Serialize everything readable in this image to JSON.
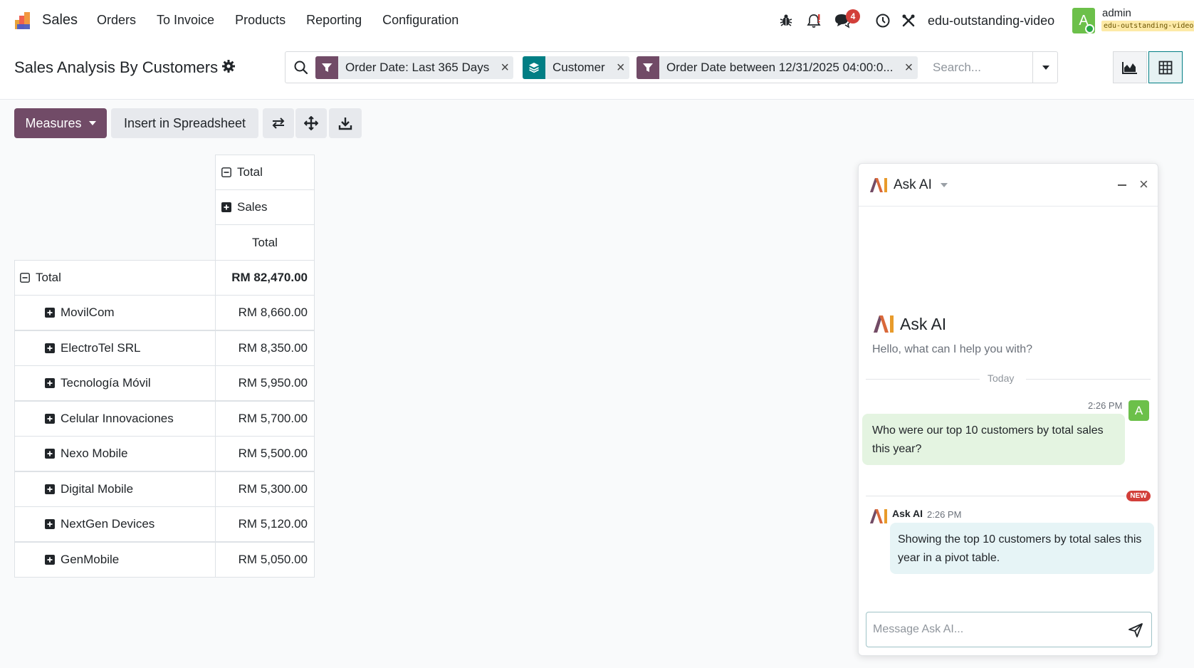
{
  "nav": {
    "app": "Sales",
    "menu": [
      "Orders",
      "To Invoice",
      "Products",
      "Reporting",
      "Configuration"
    ],
    "message_count": "4",
    "database": "edu-outstanding-video",
    "user": {
      "initial": "A",
      "name": "admin",
      "db_badge": "edu-outstanding-video"
    }
  },
  "control": {
    "title": "Sales Analysis By Customers",
    "facets": [
      {
        "label": "Order Date: Last 365 Days",
        "type": "filter"
      },
      {
        "label": "Customer",
        "type": "groupby"
      },
      {
        "label": "Order Date between 12/31/2025 04:00:0...",
        "type": "filter"
      }
    ],
    "search_placeholder": "Search..."
  },
  "toolbar": {
    "measures": "Measures",
    "insert": "Insert in Spreadsheet"
  },
  "pivot": {
    "col_total": "Total",
    "col_measure_group": "Sales",
    "col_measure": "Total",
    "row_total_label": "Total",
    "row_total_value": "RM 82,470.00",
    "rows": [
      {
        "label": "MovilCom",
        "value": "RM 8,660.00"
      },
      {
        "label": "ElectroTel SRL",
        "value": "RM 8,350.00"
      },
      {
        "label": "Tecnología Móvil",
        "value": "RM 5,950.00"
      },
      {
        "label": "Celular Innovaciones",
        "value": "RM 5,700.00"
      },
      {
        "label": "Nexo Mobile",
        "value": "RM 5,500.00"
      },
      {
        "label": "Digital Mobile",
        "value": "RM 5,300.00"
      },
      {
        "label": "NextGen Devices",
        "value": "RM 5,120.00"
      },
      {
        "label": "GenMobile",
        "value": "RM 5,050.00"
      }
    ]
  },
  "ai": {
    "title": "Ask AI",
    "welcome_title": "Ask AI",
    "hello": "Hello, what can I help you with?",
    "day_label": "Today",
    "user_time": "2:26 PM",
    "user_initial": "A",
    "user_message": "Who were our top 10 customers by total sales this year?",
    "new_badge": "NEW",
    "ai_sender": "Ask AI",
    "ai_time": "2:26 PM",
    "ai_message": "Showing the top 10 customers by total sales this year in a pivot table.",
    "input_placeholder": "Message Ask AI..."
  },
  "colors": {
    "brand": "#714b67",
    "teal": "#017e84",
    "user_bubble": "#e4f4e1",
    "ai_bubble": "#e6f4f6",
    "badge": "#d23f3a"
  }
}
